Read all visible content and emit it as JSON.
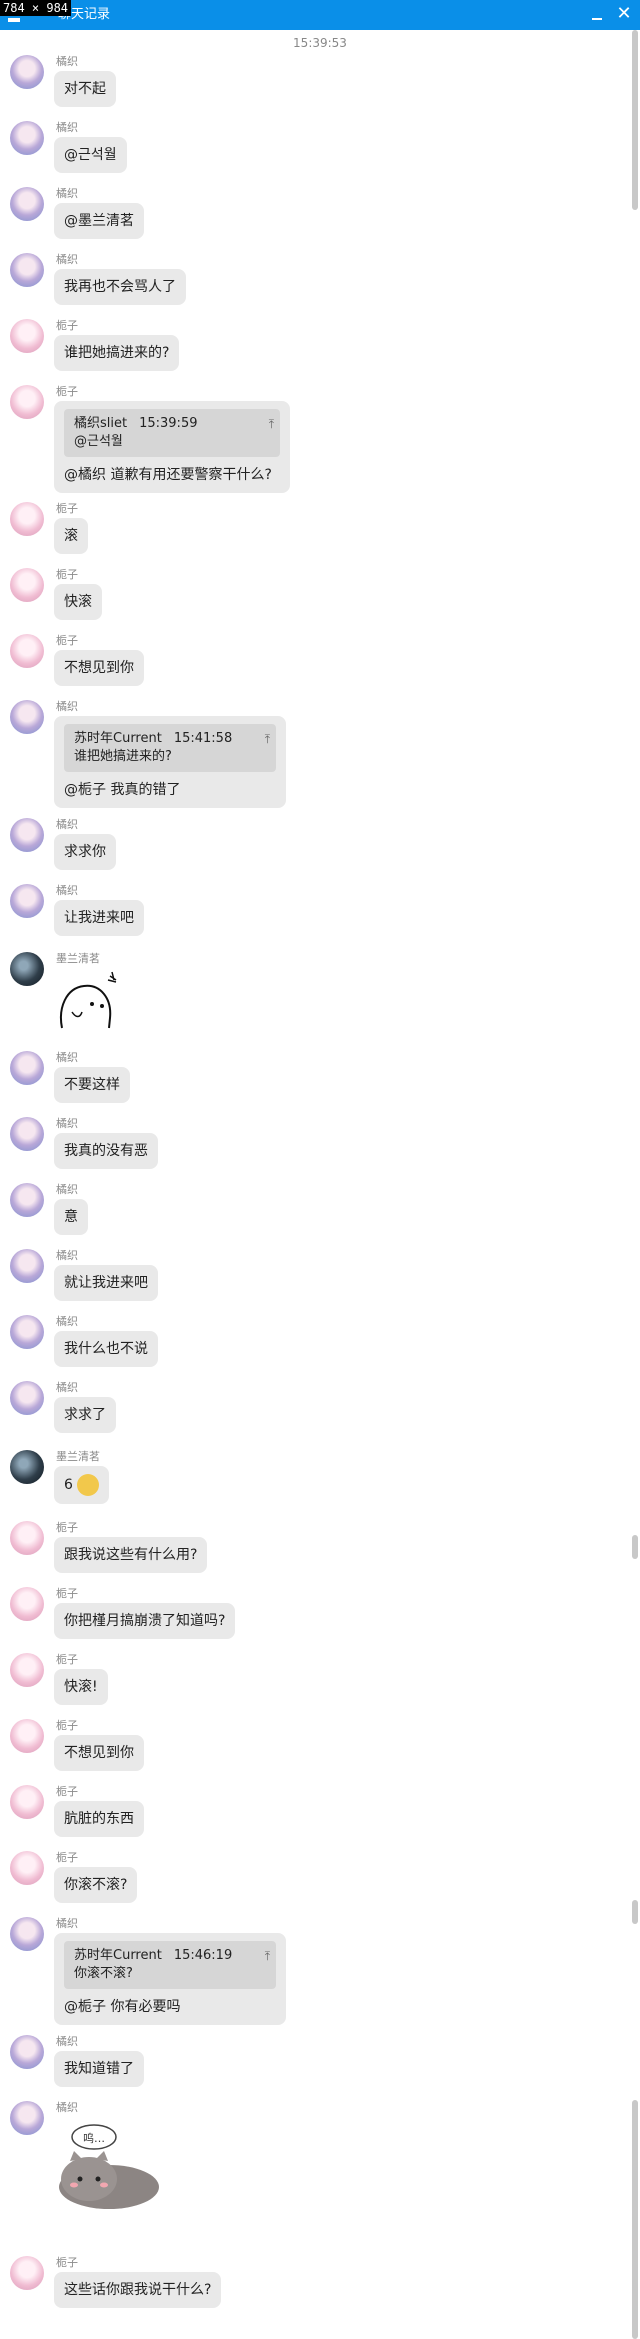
{
  "window": {
    "dimensions_label": "784 × 984",
    "title": "聊天记录",
    "close_glyph": "✕"
  },
  "timestamp": "15:39:53",
  "messages": [
    {
      "sender": "橘织",
      "text": "对不起"
    },
    {
      "sender": "橘织",
      "text": "@근석월"
    },
    {
      "sender": "橘织",
      "text": "@墨兰清茗"
    },
    {
      "sender": "橘织",
      "text": "我再也不会骂人了"
    },
    {
      "sender": "栀子",
      "text": "谁把她搞进来的?"
    },
    {
      "sender": "栀子",
      "quote": {
        "name": "橘织sliet",
        "time": "15:39:59",
        "text": "@근석월"
      },
      "text": "@橘织 道歉有用还要警察干什么?"
    },
    {
      "sender": "栀子",
      "text": "滚"
    },
    {
      "sender": "栀子",
      "text": "快滚"
    },
    {
      "sender": "栀子",
      "text": "不想见到你"
    },
    {
      "sender": "橘织",
      "quote": {
        "name": "苏时年Current",
        "time": "15:41:58",
        "text": "谁把她搞进来的?"
      },
      "text": "@栀子 我真的错了"
    },
    {
      "sender": "橘织",
      "text": "求求你"
    },
    {
      "sender": "橘织",
      "text": "让我进来吧"
    },
    {
      "sender": "墨兰清茗",
      "sticker": "cartoon-sticker"
    },
    {
      "sender": "橘织",
      "text": "不要这样"
    },
    {
      "sender": "橘织",
      "text": "我真的没有恶"
    },
    {
      "sender": "橘织",
      "text": "意"
    },
    {
      "sender": "橘织",
      "text": "就让我进来吧"
    },
    {
      "sender": "橘织",
      "text": "我什么也不说"
    },
    {
      "sender": "橘织",
      "text": "求求了"
    },
    {
      "sender": "墨兰清茗",
      "text": "6"
    },
    {
      "sender": "栀子",
      "text": "跟我说这些有什么用?"
    },
    {
      "sender": "栀子",
      "text": "你把槿月搞崩溃了知道吗?"
    },
    {
      "sender": "栀子",
      "text": "快滚!"
    },
    {
      "sender": "栀子",
      "text": "不想见到你"
    },
    {
      "sender": "栀子",
      "text": "肮脏的东西"
    },
    {
      "sender": "栀子",
      "text": "你滚不滚?"
    },
    {
      "sender": "橘织",
      "quote": {
        "name": "苏时年Current",
        "time": "15:46:19",
        "text": "你滚不滚?"
      },
      "text": "@栀子 你有必要吗"
    },
    {
      "sender": "橘织",
      "text": "我知道错了"
    },
    {
      "sender": "橘织",
      "sticker": "cat-sticker",
      "sticker_caption": "呜…"
    },
    {
      "sender": "栀子",
      "text": "这些话你跟我说干什么?"
    }
  ]
}
